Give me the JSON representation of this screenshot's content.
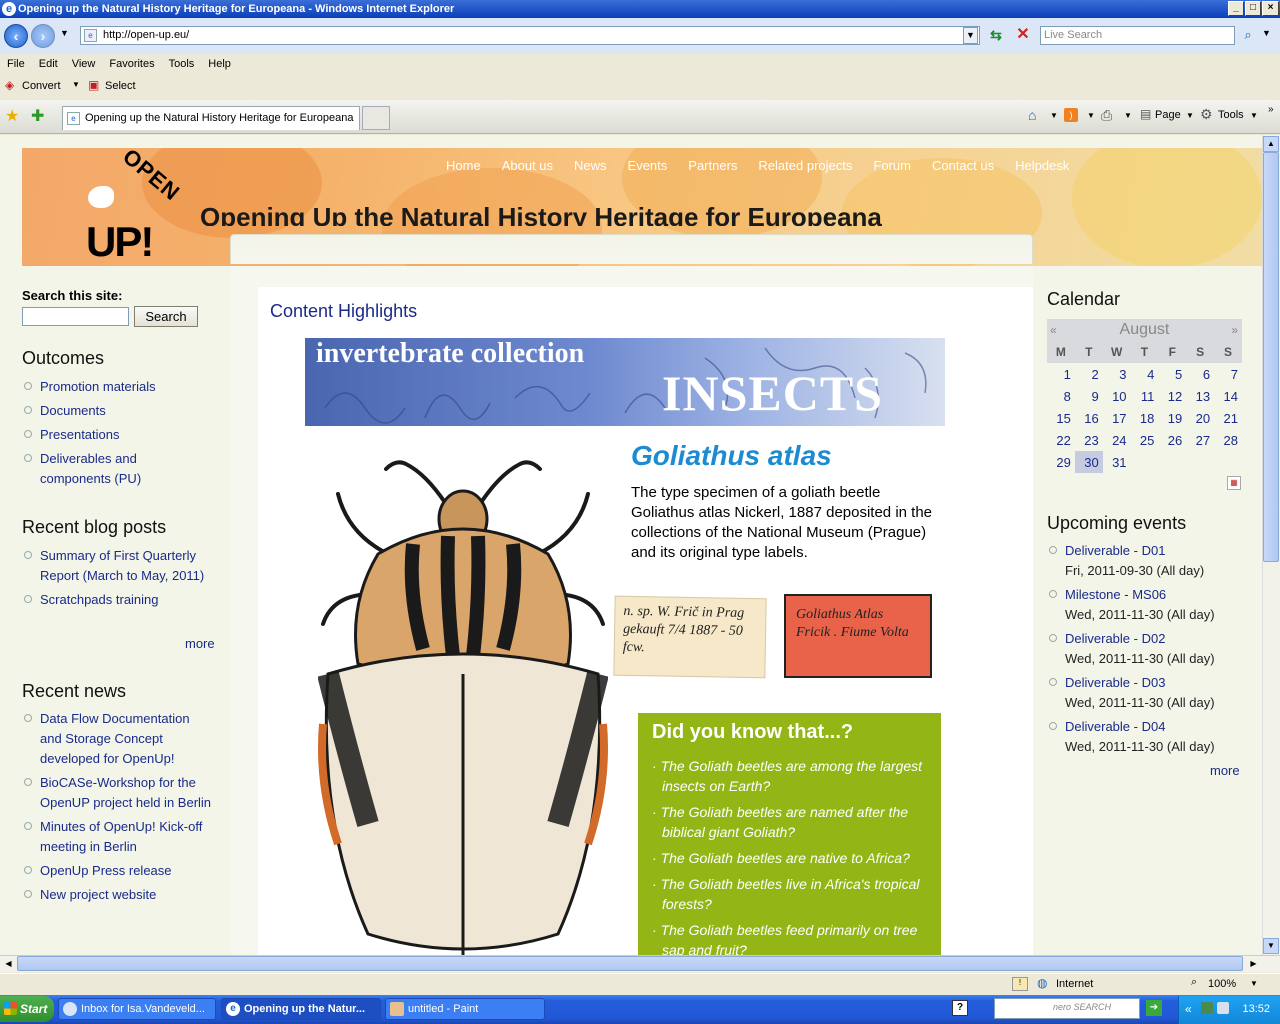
{
  "window": {
    "title": "Opening up the Natural History Heritage for Europeana - Windows Internet Explorer"
  },
  "address": {
    "url": "http://open-up.eu/",
    "live_search_placeholder": "Live Search"
  },
  "menubar": [
    "File",
    "Edit",
    "View",
    "Favorites",
    "Tools",
    "Help"
  ],
  "linksbar": {
    "convert": "Convert",
    "select": "Select"
  },
  "tab": {
    "title": "Opening up the Natural History Heritage for Europeana"
  },
  "commandbar": {
    "page": "Page",
    "tools": "Tools"
  },
  "site": {
    "logo_top": "OPEN",
    "logo_bottom": "UP!",
    "title": "Opening Up the Natural History Heritage for Europeana",
    "nav": [
      "Home",
      "About us",
      "News",
      "Events",
      "Partners",
      "Related projects",
      "Forum",
      "Contact us",
      "Helpdesk"
    ]
  },
  "search": {
    "label": "Search this site:",
    "button": "Search",
    "value": ""
  },
  "outcomes": {
    "title": "Outcomes",
    "items": [
      "Promotion materials",
      "Documents",
      "Presentations",
      "Deliverables and components (PU)"
    ]
  },
  "blog": {
    "title": "Recent blog posts",
    "items": [
      "Summary of First Quarterly Report (March to May, 2011)",
      "Scratchpads training"
    ],
    "more": "more"
  },
  "news": {
    "title": "Recent news",
    "items": [
      "Data Flow Documentation and Storage Concept developed for OpenUp!",
      "BioCASe-Workshop for the OpenUP project held in Berlin",
      "Minutes of OpenUp! Kick-off meeting in Berlin",
      "OpenUp Press release",
      "New project website"
    ]
  },
  "highlights": {
    "title": "Content Highlights",
    "banner_sub": "invertebrate collection",
    "banner_main": "INSECTS",
    "species": "Goliathus atlas",
    "description": "The type specimen of a goliath beetle Goliathus atlas Nickerl, 1887 deposited in the collections of the National Museum (Prague) and its original type labels.",
    "label1": "n. sp. W. Frič in Prag gekauft 7/4 1887 - 50 fcw.",
    "label2": "Goliathus Atlas Fricik . Fiume Volta",
    "dyk_title": "Did you know that...?",
    "facts": [
      "The Goliath beetles are among the largest insects on Earth?",
      "The Goliath beetles are named after the biblical giant Goliath?",
      "The Goliath beetles are native to Africa?",
      "The Goliath beetles live in Africa's tropical forests?",
      "The Goliath beetles feed primarily on tree sap and fruit?"
    ]
  },
  "calendar": {
    "title": "Calendar",
    "month": "August",
    "prev": "«",
    "next": "»",
    "weekdays": [
      "M",
      "T",
      "W",
      "T",
      "F",
      "S",
      "S"
    ],
    "weeks": [
      [
        "",
        "1",
        "2",
        "3",
        "4",
        "5",
        "6",
        "7"
      ],
      [
        "8",
        "9",
        "10",
        "11",
        "12",
        "13",
        "14"
      ],
      [
        "15",
        "16",
        "17",
        "18",
        "19",
        "20",
        "21"
      ],
      [
        "22",
        "23",
        "24",
        "25",
        "26",
        "27",
        "28"
      ],
      [
        "29",
        "30",
        "31",
        "",
        "",
        "",
        ""
      ]
    ],
    "today": "30"
  },
  "events": {
    "title": "Upcoming events",
    "items": [
      {
        "name": "Deliverable - D01",
        "date": "Fri, 2011-09-30 (All day)"
      },
      {
        "name": "Milestone - MS06",
        "date": "Wed, 2011-11-30 (All day)"
      },
      {
        "name": "Deliverable - D02",
        "date": "Wed, 2011-11-30 (All day)"
      },
      {
        "name": "Deliverable - D03",
        "date": "Wed, 2011-11-30 (All day)"
      },
      {
        "name": "Deliverable - D04",
        "date": "Wed, 2011-11-30 (All day)"
      }
    ],
    "more": "more"
  },
  "status": {
    "zone": "Internet",
    "zoom": "100%"
  },
  "taskbar": {
    "start": "Start",
    "items": [
      "Inbox for Isa.Vandeveld...",
      "Opening up the Natur...",
      "untitled - Paint"
    ],
    "search_brand": "nero SEARCH",
    "clock": "13:52"
  },
  "colors": {
    "accent": "#1a2a8a",
    "dyk_bg": "#93b616",
    "species": "#1c8bd1",
    "taskbar": "#245edb"
  }
}
